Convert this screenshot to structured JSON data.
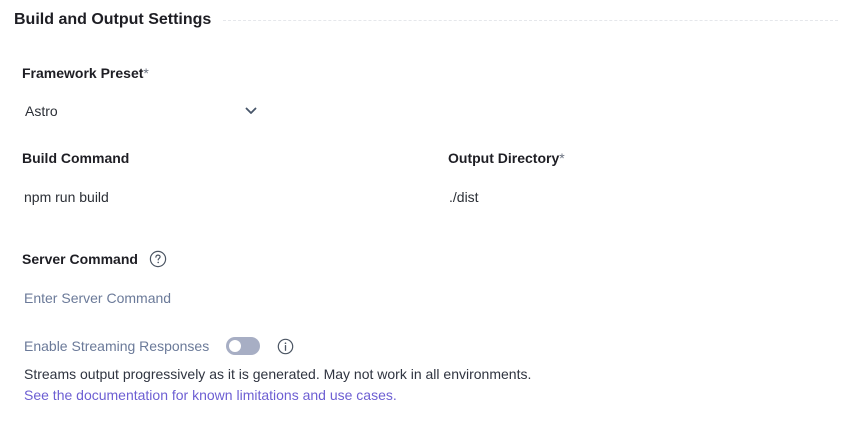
{
  "section": {
    "title": "Build and Output Settings"
  },
  "framework": {
    "label": "Framework Preset",
    "required_mark": "*",
    "selected": "Astro",
    "chevron_icon": "chevron-down-icon"
  },
  "build_command": {
    "label": "Build Command",
    "value": "npm run build"
  },
  "output_directory": {
    "label": "Output Directory",
    "required_mark": "*",
    "value": "./dist"
  },
  "server_command": {
    "label": "Server Command",
    "value": "",
    "placeholder": "Enter Server Command",
    "help_icon": "question-circle-icon"
  },
  "streaming": {
    "label": "Enable Streaming Responses",
    "enabled": false,
    "info_icon": "info-circle-icon",
    "description": "Streams output progressively as it is generated. May not work in all environments.",
    "link_text": "See the documentation for known limitations and use cases."
  },
  "colors": {
    "link": "#6d5fd3",
    "toggle_off": "#a7aec4",
    "muted_text": "#6b7a99"
  }
}
